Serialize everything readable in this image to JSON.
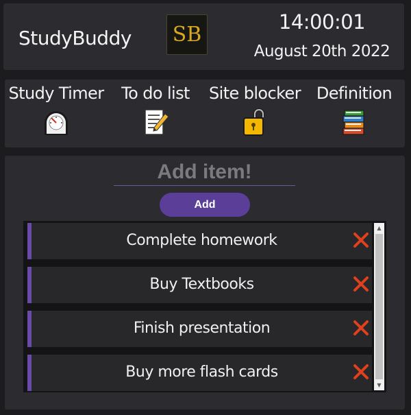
{
  "header": {
    "app_title": "StudyBuddy",
    "logo_text": "SB",
    "time": "14:00:01",
    "date": "August 20th 2022"
  },
  "nav": {
    "items": [
      {
        "label": "Study Timer",
        "icon": "stopwatch-icon"
      },
      {
        "label": "To do list",
        "icon": "memo-icon"
      },
      {
        "label": "Site blocker",
        "icon": "lock-icon"
      },
      {
        "label": "Definition",
        "icon": "books-icon"
      }
    ]
  },
  "todo": {
    "input_placeholder": "Add item!",
    "input_value": "",
    "add_label": "Add",
    "items": [
      {
        "text": "Complete homework"
      },
      {
        "text": "Buy Textbooks"
      },
      {
        "text": "Finish presentation"
      },
      {
        "text": "Buy more flash cards"
      }
    ],
    "delete_icon": "cross-mark-icon"
  },
  "colors": {
    "background": "#1c1c1f",
    "panel": "#2c2c30",
    "accent": "#5a3e98",
    "logo_gold": "#d8a820",
    "delete_red": "#e0401e"
  }
}
